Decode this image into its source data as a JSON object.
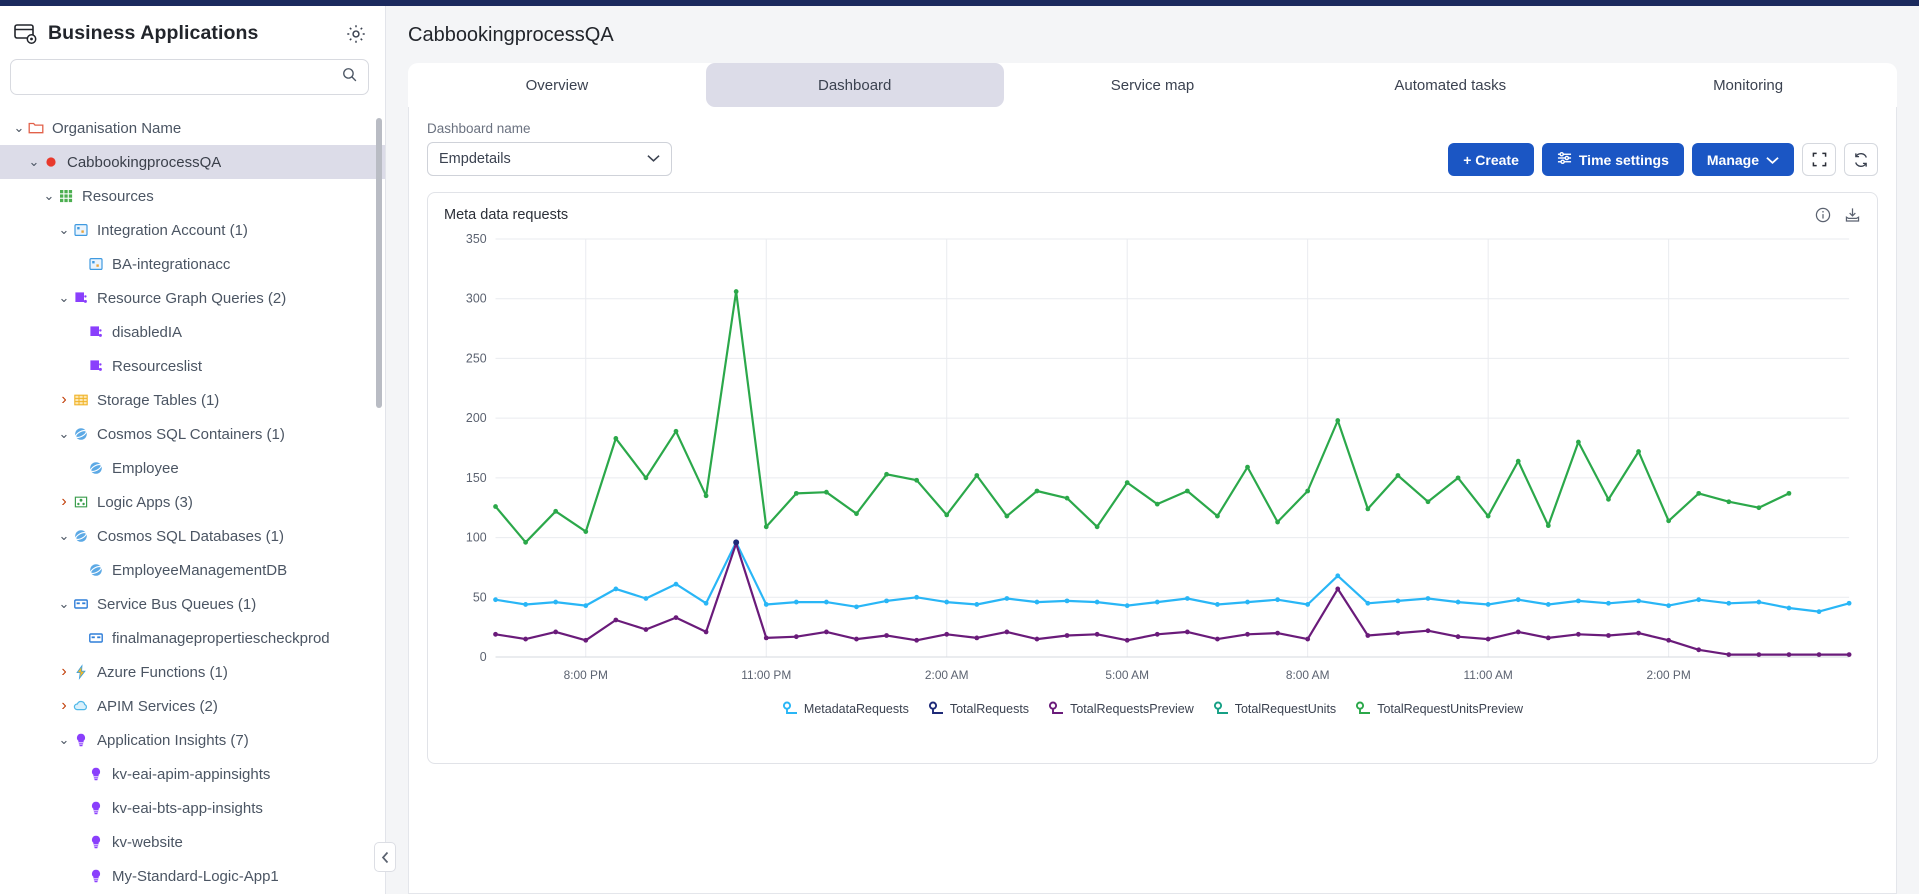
{
  "sidebar": {
    "title": "Business Applications",
    "logo_icon": "app-grid-icon",
    "settings_icon": "gear-icon",
    "search": {
      "value": "",
      "placeholder": "",
      "icon": "search-icon"
    },
    "tree": [
      {
        "label": "Organisation Name",
        "depth": 0,
        "chevron": "down",
        "icon": "folder-icon",
        "icon_color": "#e2614a",
        "selected": false
      },
      {
        "label": "CabbookingprocessQA",
        "depth": 1,
        "chevron": "down",
        "icon": "status-dot-icon",
        "icon_color": "#e8392c",
        "selected": true
      },
      {
        "label": "Resources",
        "depth": 2,
        "chevron": "down",
        "icon": "grid-icon",
        "icon_color": "#4caf50",
        "selected": false
      },
      {
        "label": "Integration Account (1)",
        "depth": 3,
        "chevron": "down",
        "icon": "integration-account-icon",
        "icon_color": "#3f9ae0",
        "selected": false
      },
      {
        "label": "BA-integrationacc",
        "depth": 4,
        "chevron": "none",
        "icon": "integration-account-icon",
        "icon_color": "#3f9ae0",
        "selected": false
      },
      {
        "label": "Resource Graph Queries (2)",
        "depth": 3,
        "chevron": "down",
        "icon": "resource-graph-icon",
        "icon_color": "#8a3ffc",
        "selected": false
      },
      {
        "label": "disabledIA",
        "depth": 4,
        "chevron": "none",
        "icon": "resource-graph-icon",
        "icon_color": "#8a3ffc",
        "selected": false
      },
      {
        "label": "Resourceslist",
        "depth": 4,
        "chevron": "none",
        "icon": "resource-graph-icon",
        "icon_color": "#8a3ffc",
        "selected": false
      },
      {
        "label": "Storage Tables (1)",
        "depth": 3,
        "chevron": "right",
        "icon": "storage-table-icon",
        "icon_color": "#f0b429",
        "selected": false
      },
      {
        "label": "Cosmos SQL Containers (1)",
        "depth": 3,
        "chevron": "down",
        "icon": "cosmos-db-icon",
        "icon_color": "#3f9ae0",
        "selected": false
      },
      {
        "label": "Employee",
        "depth": 4,
        "chevron": "none",
        "icon": "cosmos-db-icon",
        "icon_color": "#3f9ae0",
        "selected": false
      },
      {
        "label": "Logic Apps (3)",
        "depth": 3,
        "chevron": "right",
        "icon": "logic-app-icon",
        "icon_color": "#3c9e4e",
        "selected": false
      },
      {
        "label": "Cosmos SQL Databases (1)",
        "depth": 3,
        "chevron": "down",
        "icon": "cosmos-db-icon",
        "icon_color": "#3f9ae0",
        "selected": false
      },
      {
        "label": "EmployeeManagementDB",
        "depth": 4,
        "chevron": "none",
        "icon": "cosmos-db-icon",
        "icon_color": "#3f9ae0",
        "selected": false
      },
      {
        "label": "Service Bus Queues (1)",
        "depth": 3,
        "chevron": "down",
        "icon": "service-bus-icon",
        "icon_color": "#2f7ed8",
        "selected": false
      },
      {
        "label": "finalmanagepropertiescheckprod",
        "depth": 4,
        "chevron": "none",
        "icon": "service-bus-icon",
        "icon_color": "#2f7ed8",
        "selected": false
      },
      {
        "label": "Azure Functions (1)",
        "depth": 3,
        "chevron": "right",
        "icon": "azure-function-icon",
        "icon_color": "#f5b724",
        "selected": false
      },
      {
        "label": "APIM Services (2)",
        "depth": 3,
        "chevron": "right",
        "icon": "apim-icon",
        "icon_color": "#4fb8e8",
        "selected": false
      },
      {
        "label": "Application Insights (7)",
        "depth": 3,
        "chevron": "down",
        "icon": "app-insights-icon",
        "icon_color": "#8a3ffc",
        "selected": false
      },
      {
        "label": "kv-eai-apim-appinsights",
        "depth": 4,
        "chevron": "none",
        "icon": "app-insights-icon",
        "icon_color": "#8a3ffc",
        "selected": false
      },
      {
        "label": "kv-eai-bts-app-insights",
        "depth": 4,
        "chevron": "none",
        "icon": "app-insights-icon",
        "icon_color": "#8a3ffc",
        "selected": false
      },
      {
        "label": "kv-website",
        "depth": 4,
        "chevron": "none",
        "icon": "app-insights-icon",
        "icon_color": "#8a3ffc",
        "selected": false
      },
      {
        "label": "My-Standard-Logic-App1",
        "depth": 4,
        "chevron": "none",
        "icon": "app-insights-icon",
        "icon_color": "#8a3ffc",
        "selected": false
      }
    ],
    "collapse_icon": "chevron-left-icon"
  },
  "header": {
    "title": "CabbookingprocessQA"
  },
  "tabs": [
    {
      "label": "Overview",
      "active": false
    },
    {
      "label": "Dashboard",
      "active": true
    },
    {
      "label": "Service map",
      "active": false
    },
    {
      "label": "Automated tasks",
      "active": false
    },
    {
      "label": "Monitoring",
      "active": false
    }
  ],
  "toolbar": {
    "dashboard_label": "Dashboard name",
    "dashboard_value": "Empdetails",
    "create_label": "+ Create",
    "time_settings_label": "Time settings",
    "manage_label": "Manage",
    "fullscreen_icon": "fullscreen-icon",
    "refresh_icon": "refresh-icon",
    "accent_color": "#1b56c4"
  },
  "card": {
    "title": "Meta data requests",
    "info_icon": "info-icon",
    "export_icon": "download-icon"
  },
  "chart_data": {
    "type": "line",
    "title": "Meta data requests",
    "xlabel": "",
    "ylabel": "",
    "ylim": [
      0,
      350
    ],
    "yticks": [
      0,
      50,
      100,
      150,
      200,
      250,
      300,
      350
    ],
    "xticks": [
      "8:00 PM",
      "11:00 PM",
      "2:00 AM",
      "5:00 AM",
      "8:00 AM",
      "11:00 AM",
      "2:00 PM"
    ],
    "xtick_positions": [
      3,
      9,
      15,
      21,
      27,
      33,
      39
    ],
    "grid": true,
    "legend_position": "bottom",
    "n_points": 46,
    "series": [
      {
        "name": "MetadataRequests",
        "color": "#29b6f6",
        "values": [
          48,
          44,
          46,
          43,
          57,
          49,
          61,
          45,
          96,
          44,
          46,
          46,
          42,
          47,
          50,
          46,
          44,
          49,
          46,
          47,
          46,
          43,
          46,
          49,
          44,
          46,
          48,
          44,
          68,
          45,
          47,
          49,
          46,
          44,
          48,
          44,
          47,
          45,
          47,
          43,
          48,
          45,
          46,
          41,
          38,
          45
        ]
      },
      {
        "name": "TotalRequests",
        "color": "#1e2a78",
        "values": [
          0,
          0,
          0,
          0,
          0,
          0,
          0,
          0,
          96,
          0,
          0,
          0,
          0,
          0,
          0,
          0,
          0,
          0,
          0,
          0,
          0,
          0,
          0,
          0,
          0,
          0,
          0,
          0,
          0,
          0,
          0,
          0,
          0,
          0,
          0,
          0,
          0,
          0,
          0,
          0,
          0,
          0,
          0,
          0,
          0,
          0
        ]
      },
      {
        "name": "TotalRequestsPreview",
        "color": "#6a1b7a",
        "values": [
          19,
          15,
          21,
          14,
          31,
          23,
          33,
          21,
          95,
          16,
          17,
          21,
          15,
          18,
          14,
          19,
          16,
          21,
          15,
          18,
          19,
          14,
          19,
          21,
          15,
          19,
          20,
          15,
          57,
          18,
          20,
          22,
          17,
          15,
          21,
          16,
          19,
          18,
          20,
          14,
          6,
          2,
          2,
          2,
          2,
          2
        ]
      },
      {
        "name": "TotalRequestUnits",
        "color": "#16a085",
        "values": [
          0,
          0,
          0,
          0,
          0,
          0,
          0,
          0,
          0,
          0,
          0,
          0,
          0,
          0,
          0,
          0,
          0,
          0,
          0,
          0,
          0,
          0,
          0,
          0,
          0,
          0,
          0,
          0,
          0,
          0,
          0,
          0,
          0,
          0,
          0,
          0,
          0,
          0,
          0,
          0,
          0,
          0,
          0,
          0,
          0,
          0
        ]
      },
      {
        "name": "TotalRequestUnitsPreview",
        "color": "#2ba84a",
        "values": [
          126,
          96,
          122,
          105,
          183,
          150,
          189,
          135,
          306,
          109,
          137,
          138,
          120,
          153,
          148,
          119,
          152,
          118,
          139,
          133,
          109,
          146,
          128,
          139,
          118,
          159,
          113,
          139,
          198,
          124,
          152,
          130,
          150,
          118,
          164,
          110,
          180,
          132,
          172,
          114,
          137,
          130,
          125,
          137,
          0,
          0
        ]
      }
    ]
  }
}
